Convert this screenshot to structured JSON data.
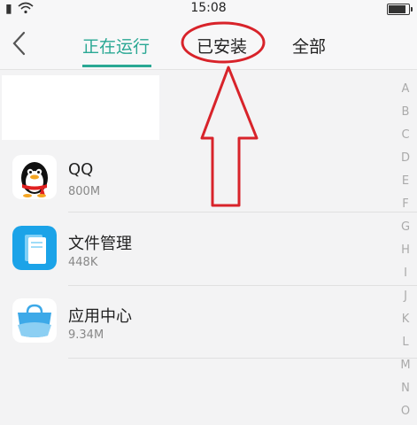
{
  "status_bar": {
    "time": "15:08",
    "battery_level": 0.85
  },
  "header": {
    "back_icon": "chevron-left-icon",
    "tabs": [
      {
        "label": "正在运行",
        "active": true
      },
      {
        "label": "已安装",
        "active": false
      },
      {
        "label": "全部",
        "active": false
      }
    ]
  },
  "apps": [
    {
      "name": "QQ",
      "size": "800M",
      "icon": "qq-penguin-icon"
    },
    {
      "name": "文件管理",
      "size": "448K",
      "icon": "file-manager-icon"
    },
    {
      "name": "应用中心",
      "size": "9.34M",
      "icon": "app-center-icon"
    }
  ],
  "index_letters": [
    "A",
    "B",
    "C",
    "D",
    "E",
    "F",
    "G",
    "H",
    "I",
    "J",
    "K",
    "L",
    "M",
    "N",
    "O"
  ],
  "annotation": {
    "color": "#d8232a"
  },
  "colors": {
    "accent": "#2aa894",
    "annotation": "#d8232a"
  }
}
